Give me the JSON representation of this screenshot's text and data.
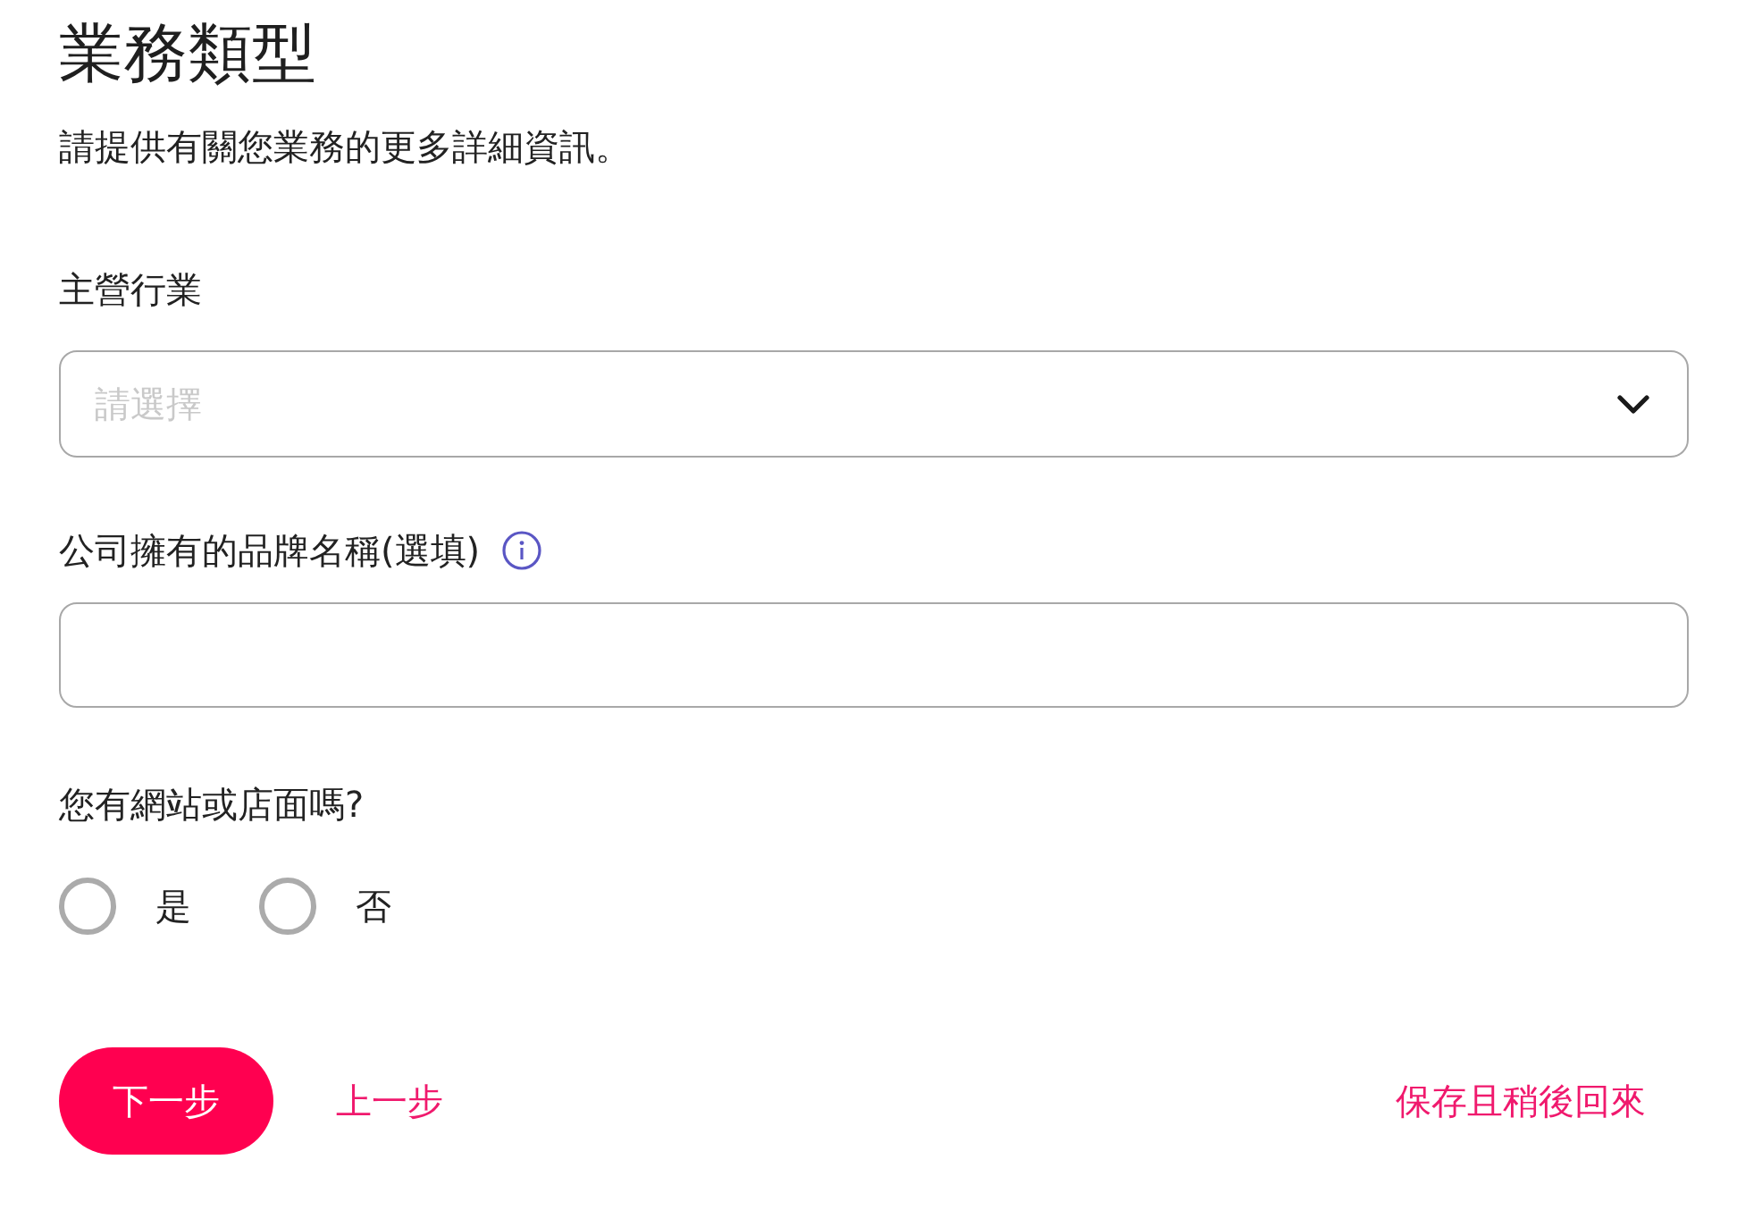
{
  "page": {
    "title": "業務類型",
    "subtitle": "請提供有關您業務的更多詳細資訊。"
  },
  "fields": [
    {
      "kind": "select",
      "label": "主營行業",
      "placeholder": "請選擇"
    },
    {
      "kind": "text",
      "label": "公司擁有的品牌名稱(選填)",
      "info": true
    },
    {
      "kind": "radio",
      "label": "您有網站或店面嗎?",
      "options": [
        {
          "label": "是",
          "selected": false
        },
        {
          "label": "否",
          "selected": false
        }
      ]
    }
  ],
  "actions": [
    {
      "kind": "primary",
      "label": "下一步"
    },
    {
      "kind": "link",
      "label": "上一步"
    },
    {
      "kind": "link-end",
      "label": "保存且稍後回來"
    }
  ]
}
